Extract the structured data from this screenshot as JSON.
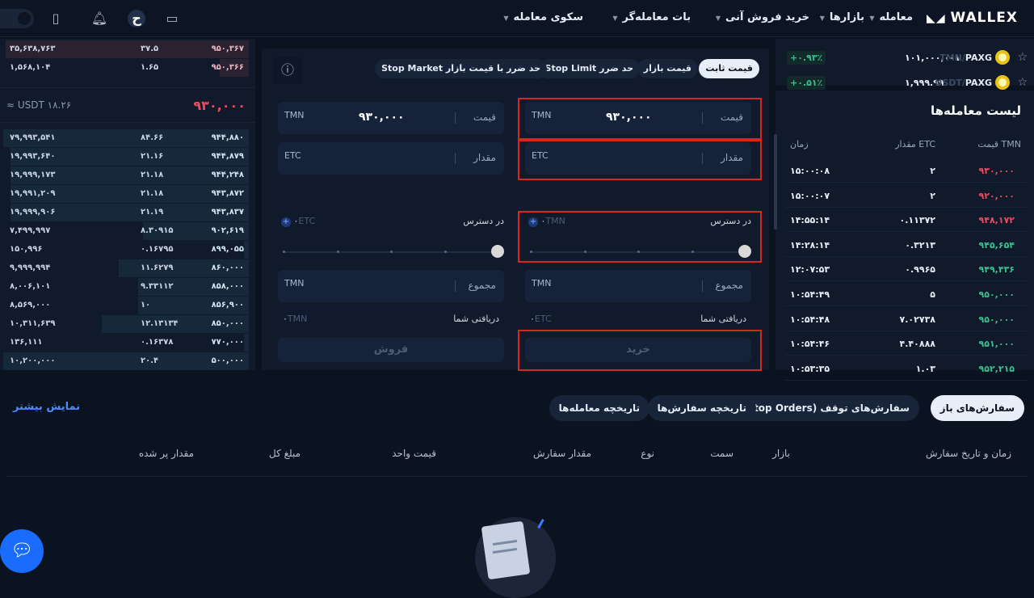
{
  "brand": "WALLEX",
  "nav": [
    {
      "label": "معامله"
    },
    {
      "label": "بازارها"
    },
    {
      "label": "خرید فروش آنی"
    },
    {
      "label": "بات معامله‌گر"
    },
    {
      "label": "سکوی معامله"
    }
  ],
  "user_initial": "ح",
  "markets": [
    {
      "pair_quote": "TMN/",
      "pair_base": "PAXG",
      "price": "۱۰۱,۰۰۰,۰۰۱",
      "change": "+۰.۹۳٪"
    },
    {
      "pair_quote": "USDT/",
      "pair_base": "PAXG",
      "price": "۱,۹۹۹.۹۹",
      "change": "+۰.۵۱٪"
    }
  ],
  "orderbook": {
    "asks": [
      {
        "total": "۳۵,۶۳۸,۷۶۳",
        "amount": "۳۷.۵",
        "price": "۹۵۰,۳۶۷",
        "fill": 0.99
      },
      {
        "total": "۱,۵۶۸,۱۰۴",
        "amount": "۱.۶۵",
        "price": "۹۵۰,۳۶۶",
        "fill": 0.12
      }
    ],
    "last_price": "۹۳۰,۰۰۰",
    "last_price_usdt": "≈ USDT ۱۸.۲۶",
    "bids": [
      {
        "total": "۷۹,۹۹۳,۵۴۱",
        "amount": "۸۴.۶۶",
        "price": "۹۴۴,۸۸۰",
        "fill": 1.0
      },
      {
        "total": "۱۹,۹۹۳,۶۴۰",
        "amount": "۲۱.۱۶",
        "price": "۹۴۴,۸۷۹",
        "fill": 0.97
      },
      {
        "total": "۱۹,۹۹۹,۱۷۳",
        "amount": "۲۱.۱۸",
        "price": "۹۴۴,۲۴۸",
        "fill": 0.97
      },
      {
        "total": "۱۹,۹۹۱,۲۰۹",
        "amount": "۲۱.۱۸",
        "price": "۹۴۳,۸۷۲",
        "fill": 0.97
      },
      {
        "total": "۱۹,۹۹۹,۹۰۶",
        "amount": "۲۱.۱۹",
        "price": "۹۴۳,۸۳۷",
        "fill": 0.97
      },
      {
        "total": "۷,۴۹۹,۹۹۷",
        "amount": "۸.۳۰۹۱۵",
        "price": "۹۰۲,۶۱۹",
        "fill": 0.43
      },
      {
        "total": "۱۵۰,۹۹۶",
        "amount": "۰.۱۶۷۹۵",
        "price": "۸۹۹,۰۵۵",
        "fill": 0.02
      },
      {
        "total": "۹,۹۹۹,۹۹۴",
        "amount": "۱۱.۶۲۷۹",
        "price": "۸۶۰,۰۰۰",
        "fill": 0.53
      },
      {
        "total": "۸,۰۰۶,۱۰۱",
        "amount": "۹.۳۳۱۱۲",
        "price": "۸۵۸,۰۰۰",
        "fill": 0.45
      },
      {
        "total": "۸,۵۶۹,۰۰۰",
        "amount": "۱۰",
        "price": "۸۵۶,۹۰۰",
        "fill": 0.45
      },
      {
        "total": "۱۰,۳۱۱,۶۳۹",
        "amount": "۱۲.۱۳۱۳۴",
        "price": "۸۵۰,۰۰۰",
        "fill": 0.6
      },
      {
        "total": "۱۳۶,۱۱۱",
        "amount": "۰.۱۶۳۷۸",
        "price": "۷۷۰,۰۰۰",
        "fill": 0.02
      },
      {
        "total": "۱۰,۲۰۰,۰۰۰",
        "amount": "۲۰.۴",
        "price": "۵۰۰,۰۰۰",
        "fill": 1.0
      }
    ]
  },
  "order_types": [
    {
      "label": "قیمت ثابت",
      "active": true
    },
    {
      "label": "قیمت بازار"
    },
    {
      "label": "حد ضرر Stop Limit"
    },
    {
      "label": "حد ضرر با قیمت بازار Stop Market"
    }
  ],
  "buy": {
    "price_label": "قیمت",
    "price": "۹۳۰,۰۰۰",
    "price_unit": "TMN",
    "amount_label": "مقدار",
    "amount_unit": "ETC",
    "available_label": "در دسترس",
    "available": "۰",
    "available_unit": "TMN",
    "total_label": "مجموع",
    "total_unit": "TMN",
    "receive_label": "دریافتی شما",
    "receive": "۰",
    "receive_unit": "ETC",
    "button": "خرید",
    "slider_percent": 100
  },
  "sell": {
    "price_label": "قیمت",
    "price": "۹۳۰,۰۰۰",
    "price_unit": "TMN",
    "amount_label": "مقدار",
    "amount_unit": "ETC",
    "available_label": "در دسترس",
    "available": "۰",
    "available_unit": "ETC",
    "total_label": "مجموع",
    "total_unit": "TMN",
    "receive_label": "دریافتی شما",
    "receive": "۰",
    "receive_unit": "TMN",
    "button": "فروش",
    "slider_percent": 100
  },
  "trades": {
    "title": "لیست معامله‌ها",
    "headers": {
      "price": "قیمت TMN",
      "amount": "مقدار ETC",
      "time": "زمان"
    },
    "rows": [
      {
        "price": "۹۳۰,۰۰۰",
        "amount": "۲",
        "time": "۱۵:۰۰:۰۸",
        "side": "sell"
      },
      {
        "price": "۹۲۰,۰۰۰",
        "amount": "۲",
        "time": "۱۵:۰۰:۰۷",
        "side": "sell"
      },
      {
        "price": "۹۴۸,۱۷۲",
        "amount": "۰.۱۱۳۷۲",
        "time": "۱۴:۵۵:۱۴",
        "side": "sell"
      },
      {
        "price": "۹۴۵,۶۵۴",
        "amount": "۰.۳۲۱۳",
        "time": "۱۴:۲۸:۱۴",
        "side": "buy"
      },
      {
        "price": "۹۴۹,۴۳۶",
        "amount": "۰.۹۹۶۵",
        "time": "۱۲:۰۷:۵۳",
        "side": "buy"
      },
      {
        "price": "۹۵۰,۰۰۰",
        "amount": "۵",
        "time": "۱۰:۵۴:۴۹",
        "side": "buy"
      },
      {
        "price": "۹۵۰,۰۰۰",
        "amount": "۷.۰۲۷۳۸",
        "time": "۱۰:۵۴:۴۸",
        "side": "buy"
      },
      {
        "price": "۹۵۱,۰۰۰",
        "amount": "۴.۴۰۸۸۸",
        "time": "۱۰:۵۴:۴۶",
        "side": "buy"
      },
      {
        "price": "۹۵۲,۲۱۵",
        "amount": "۱.۰۳",
        "time": "۱۰:۵۳:۳۵",
        "side": "buy"
      }
    ]
  },
  "orders": {
    "tabs": [
      {
        "label": "سفارش‌های باز",
        "active": true
      },
      {
        "label": "سفارش‌های توقف (Stop Orders)"
      },
      {
        "label": "تاریخچه سفارش‌ها"
      },
      {
        "label": "تاریخچه معامله‌ها"
      }
    ],
    "show_more": "نمایش بیشتر",
    "columns": [
      "زمان و تاریخ سفارش",
      "بازار",
      "سمت",
      "نوع",
      "مقدار سفارش",
      "قیمت واحد",
      "مبلغ کل",
      "مقدار پر شده"
    ]
  },
  "colors": {
    "buy": "#3bbf8e",
    "sell": "#ef4a62",
    "accent": "#2f6bff",
    "annotation": "#d5261f"
  }
}
